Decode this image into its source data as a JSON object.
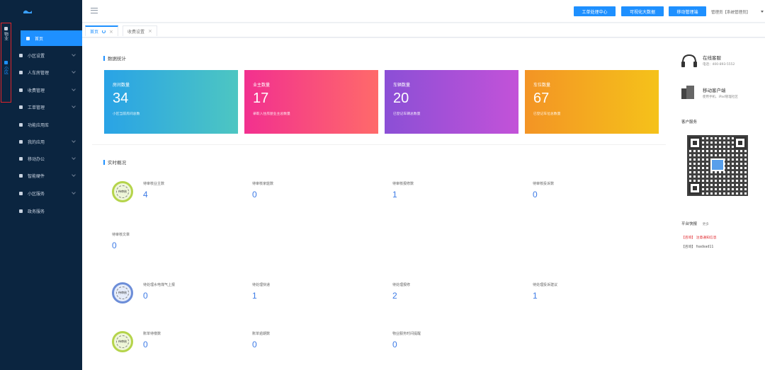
{
  "colors": {
    "accent": "#1e90ff",
    "sidebar_bg": "#0b2540",
    "rail_highlight": "#e0242a",
    "value_blue": "#3d7be6",
    "link_red": "#e0242a"
  },
  "rail": {
    "items": [
      {
        "label": "物业",
        "active": false
      },
      {
        "label": "小区",
        "active": true
      }
    ]
  },
  "sidebar": {
    "items": [
      {
        "label": "首页",
        "icon": "home-icon",
        "active": true,
        "has_arrow": false
      },
      {
        "label": "小区设置",
        "icon": "settings-icon",
        "active": false,
        "has_arrow": true
      },
      {
        "label": "人车房管理",
        "icon": "building-icon",
        "active": false,
        "has_arrow": true
      },
      {
        "label": "收费管理",
        "icon": "money-icon",
        "active": false,
        "has_arrow": true
      },
      {
        "label": "工单管理",
        "icon": "ticket-icon",
        "active": false,
        "has_arrow": true
      },
      {
        "label": "功能应用库",
        "icon": "apps-icon",
        "active": false,
        "has_arrow": false
      },
      {
        "label": "我的应用",
        "icon": "user-icon",
        "active": false,
        "has_arrow": true
      },
      {
        "label": "移动办公",
        "icon": "briefcase-icon",
        "active": false,
        "has_arrow": true
      },
      {
        "label": "智能硬件",
        "icon": "device-icon",
        "active": false,
        "has_arrow": true
      },
      {
        "label": "小区服务",
        "icon": "service-icon",
        "active": false,
        "has_arrow": true
      },
      {
        "label": "政务服务",
        "icon": "government-icon",
        "active": false,
        "has_arrow": false
      }
    ]
  },
  "topbar": {
    "buttons": [
      "工单处理中心",
      "可视化大数据",
      "移动管理端"
    ],
    "user": "管理员【系统管理员】"
  },
  "tabs": [
    {
      "label": "首页",
      "active": true
    },
    {
      "label": "收费设置",
      "active": false
    }
  ],
  "data_stats": {
    "title": "数据统计",
    "cards": [
      {
        "title": "房间数量",
        "value": "34",
        "desc": "小区当前房间总数",
        "gradient": [
          "#29a3e6",
          "#4dc6c2"
        ]
      },
      {
        "title": "业主数量",
        "value": "17",
        "desc": "录取入住房屋业主总数量",
        "gradient": [
          "#f2308f",
          "#ff6a6a"
        ]
      },
      {
        "title": "车辆数量",
        "value": "20",
        "desc": "已登记车辆总数量",
        "gradient": [
          "#8b4fd6",
          "#c352d8"
        ]
      },
      {
        "title": "车位数量",
        "value": "67",
        "desc": "已登记车位总数量",
        "gradient": [
          "#f39425",
          "#f5c21a"
        ]
      }
    ]
  },
  "realtime": {
    "title": "实时概况",
    "rows": [
      {
        "stamp": "green",
        "items": [
          {
            "label": "待审核业主数",
            "value": "4"
          },
          {
            "label": "待审核家庭数",
            "value": "0"
          },
          {
            "label": "待审核报修数",
            "value": "1"
          },
          {
            "label": "待审核投诉数",
            "value": "0"
          }
        ]
      },
      {
        "stamp": null,
        "items": [
          {
            "label": "待审核文章",
            "value": "0"
          }
        ]
      },
      {
        "stamp": "blue",
        "items": [
          {
            "label": "待处理水电煤气上报",
            "value": "0"
          },
          {
            "label": "待处理快递",
            "value": "1"
          },
          {
            "label": "待处理报修",
            "value": "2"
          },
          {
            "label": "待处理投诉建议",
            "value": "1"
          }
        ]
      },
      {
        "stamp": "green",
        "items": [
          {
            "label": "账单待缴数",
            "value": "0"
          },
          {
            "label": "账单逾期数",
            "value": "0"
          },
          {
            "label": "物业服务时间提醒",
            "value": "0"
          }
        ]
      }
    ],
    "stamp_text": "待审核"
  },
  "right_panel": {
    "online_service": {
      "title": "在线客服",
      "phone": "电话：400-893-5552"
    },
    "mobile_client": {
      "title": "移动客户端",
      "desc": "使用手机、iPad管理社区"
    },
    "customer_service_title": "客户服务",
    "news": {
      "title": "平台快报",
      "more": "更多",
      "items": [
        {
          "text": "【咨询】 注意通知信息",
          "highlight": true
        },
        {
          "text": "【咨询】 fsadsad11",
          "highlight": false
        }
      ]
    }
  }
}
